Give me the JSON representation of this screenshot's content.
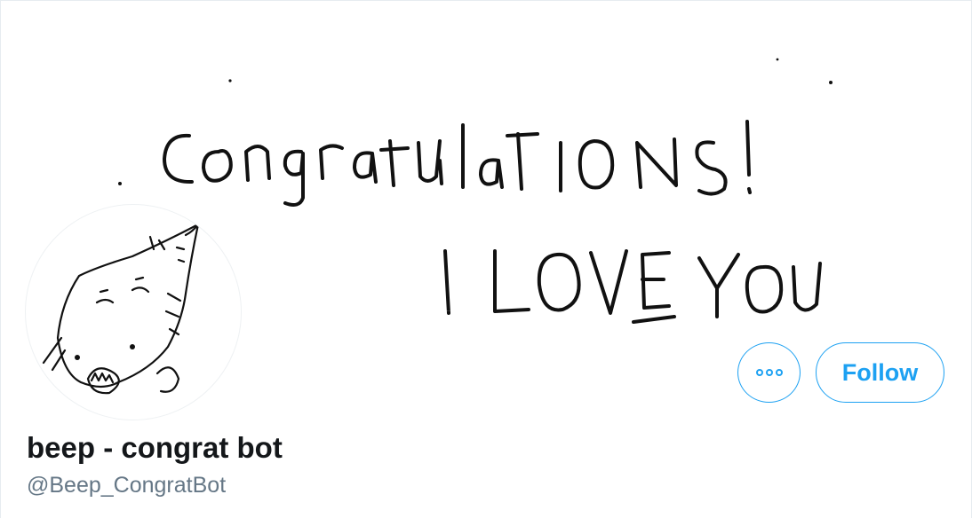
{
  "banner": {
    "line1": "Congratulations!",
    "line2": "I LOVE YOU"
  },
  "profile": {
    "display_name": "beep - congrat bot",
    "handle": "@Beep_CongratBot"
  },
  "actions": {
    "more_icon": "more-horizontal-icon",
    "follow_label": "Follow"
  },
  "colors": {
    "accent": "#1da1f2",
    "name": "#14171a",
    "handle": "#657786"
  }
}
